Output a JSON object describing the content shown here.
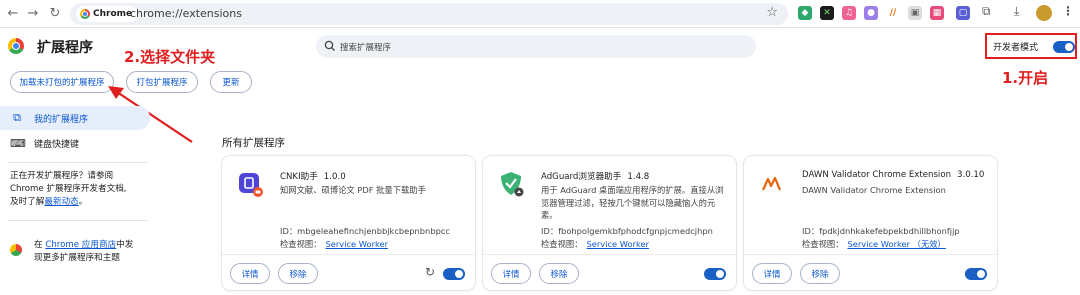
{
  "browser": {
    "chip_label": "Chrome",
    "url": "chrome://extensions"
  },
  "header": {
    "title": "扩展程序",
    "search_placeholder": "搜索扩展程序",
    "dev_mode_label": "开发者模式",
    "dev_mode_on": true
  },
  "annotations": {
    "step1": "1.开启",
    "step2": "2.选择文件夹",
    "color": "#e02020"
  },
  "actions": {
    "load_unpacked": "加载未打包的扩展程序",
    "pack": "打包扩展程序",
    "update": "更新"
  },
  "sidebar": {
    "items": [
      {
        "label": "我的扩展程序",
        "icon": "puzzle-icon",
        "active": true
      },
      {
        "label": "键盘快捷键",
        "icon": "keyboard-icon",
        "active": false
      }
    ],
    "dev_hint_line1": "正在开发扩展程序？请参阅",
    "dev_hint_line2": "Chrome 扩展程序开发者文档,",
    "dev_hint_line3_prefix": "及时了解",
    "dev_hint_link": "最新动态",
    "dev_hint_suffix": "。",
    "store_prefix": "在",
    "store_link": "Chrome 应用商店",
    "store_suffix": "中发",
    "store_line2": "现更多扩展程序和主题"
  },
  "section_title": "所有扩展程序",
  "extensions": [
    {
      "name": "CNKI助手",
      "version": "1.0.0",
      "description": "知网文献、硕博论文 PDF 批量下载助手",
      "id_label": "ID：",
      "id": "mbgeleahefinchjenbbjkcbepnbnbpcc",
      "view_label": "检查视图：",
      "view_link": "Service Worker",
      "details": "详情",
      "remove": "移除",
      "enabled": true,
      "icon": "cnki-icon"
    },
    {
      "name": "AdGuard浏览器助手",
      "version": "1.4.8",
      "description": "用于 AdGuard 桌面端应用程序的扩展。直接从浏览器管理过滤，轻按几个键就可以隐藏恼人的元素。",
      "id_label": "ID：",
      "id": "fbohpolgemkbfphodcfgnpjcmedcjhpn",
      "view_label": "检查视图：",
      "view_link": "Service Worker",
      "details": "详情",
      "remove": "移除",
      "enabled": true,
      "icon": "adguard-shield-icon"
    },
    {
      "name": "DAWN Validator Chrome Extension",
      "version": "3.0.10",
      "description": "DAWN Validator Chrome Extension",
      "id_label": "ID：",
      "id": "fpdkjdnhkakefebpekbdhillbhonfjjp",
      "view_label": "检查视图：",
      "view_link": "Service Worker （无效）",
      "details": "详情",
      "remove": "移除",
      "enabled": true,
      "icon": "dawn-icon"
    }
  ]
}
